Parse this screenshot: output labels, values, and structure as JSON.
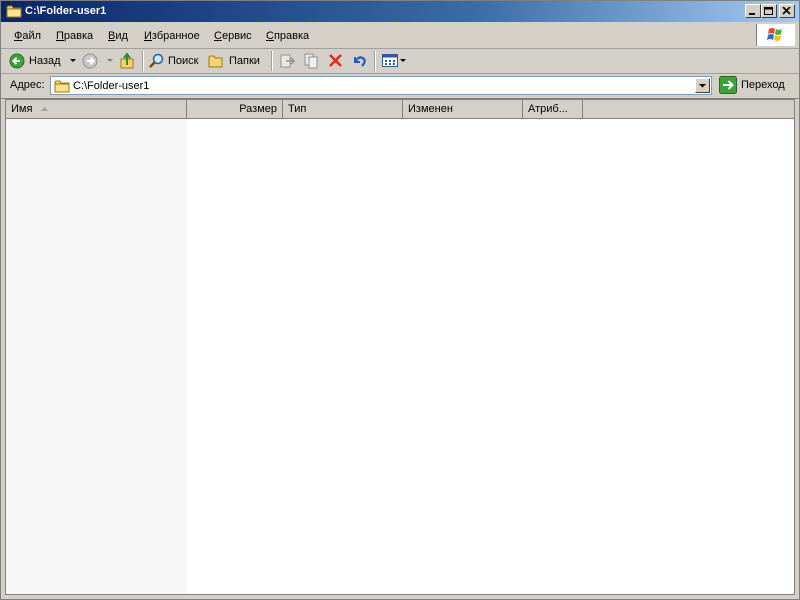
{
  "window": {
    "title": "C:\\Folder-user1"
  },
  "menu": {
    "items": [
      {
        "label_first": "Ф",
        "label_rest": "айл"
      },
      {
        "label_first": "П",
        "label_rest": "равка"
      },
      {
        "label_first": "В",
        "label_rest": "ид"
      },
      {
        "label_first": "И",
        "label_rest": "збранное"
      },
      {
        "label_first": "С",
        "label_rest": "ервис"
      },
      {
        "label_first": "С",
        "label_rest": "правка"
      }
    ]
  },
  "toolbar": {
    "back_label": "Назад",
    "search_label": "Поиск",
    "folders_label": "Папки"
  },
  "address": {
    "label": "Адрес:",
    "value": "C:\\Folder-user1",
    "go_label": "Переход"
  },
  "list": {
    "columns": [
      {
        "label": "Имя"
      },
      {
        "label": "Размер"
      },
      {
        "label": "Тип"
      },
      {
        "label": "Изменен"
      },
      {
        "label": "Атриб..."
      }
    ]
  },
  "colors": {
    "title_start": "#0a246a",
    "title_end": "#a6caf0",
    "chrome": "#d4d0c8"
  }
}
